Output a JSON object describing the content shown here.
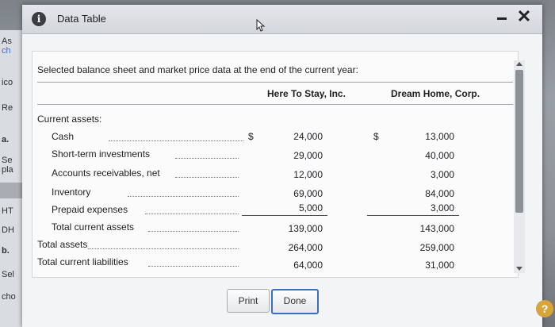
{
  "window": {
    "title": "Data Table",
    "info_icon": "i",
    "close_icon": "✕"
  },
  "background": {
    "fragments": [
      "As",
      "ch",
      "ico",
      "Re",
      "a.",
      "Se",
      "pla",
      "HT",
      "DH",
      "b.",
      "Sel",
      "cho"
    ]
  },
  "table": {
    "heading": "Selected balance sheet and market price data at the end of the current year:",
    "columns": [
      "Here To Stay, Inc.",
      "Dream Home, Corp."
    ],
    "section": "Current assets:",
    "currency": "$",
    "rows": [
      {
        "label": "Cash",
        "a": "24,000",
        "b": "13,000"
      },
      {
        "label": "Short-term investments",
        "a": "29,000",
        "b": "40,000"
      },
      {
        "label": "Accounts receivables, net",
        "a": "12,000",
        "b": "3,000"
      },
      {
        "label": "Inventory",
        "a": "69,000",
        "b": "84,000"
      },
      {
        "label": "Prepaid expenses",
        "a": "5,000",
        "b": "3,000"
      },
      {
        "label": "Total current assets",
        "a": "139,000",
        "b": "143,000"
      },
      {
        "label": "Total assets",
        "a": "264,000",
        "b": "259,000"
      },
      {
        "label": "Total current liabilities",
        "a": "64,000",
        "b": "31,000"
      }
    ]
  },
  "buttons": {
    "print": "Print",
    "done": "Done"
  },
  "help_icon": "?"
}
